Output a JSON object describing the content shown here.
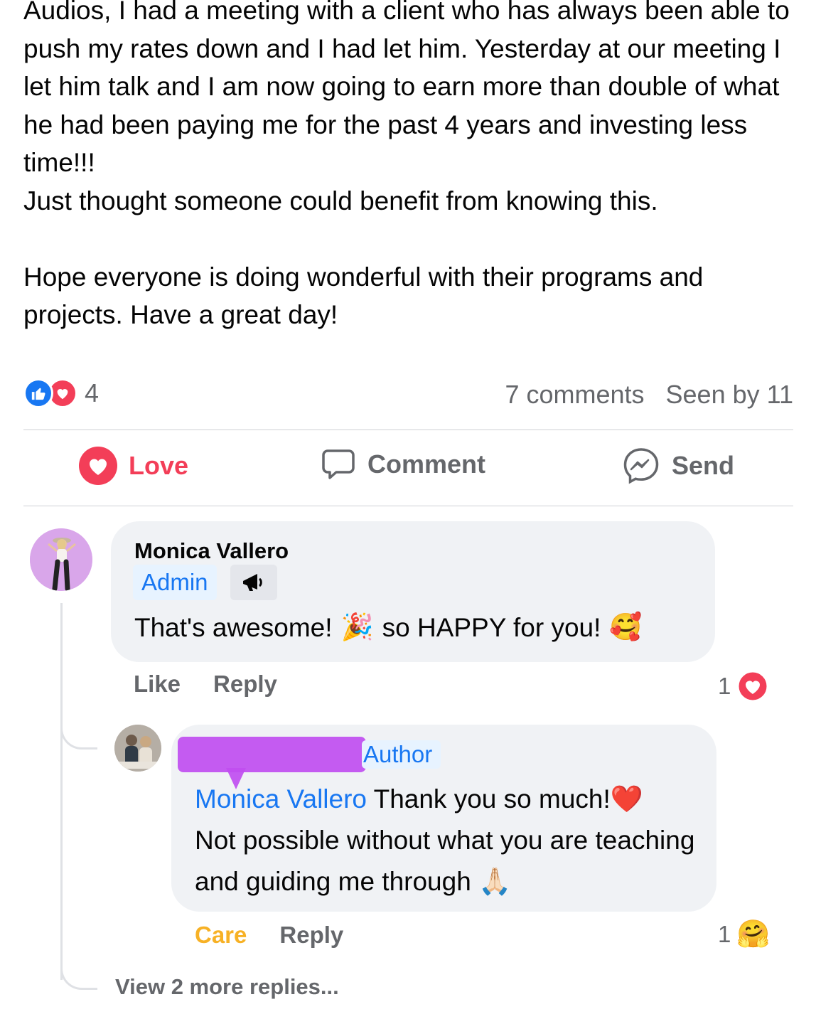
{
  "post": {
    "paragraphs": [
      "Audios, I had a meeting with a client who has always been able to push my rates down and I had let him. Yesterday at our meeting I let him talk and I am now going to earn more than double of what he had been paying me for the past 4 years and investing less time!!!\nJust thought someone could benefit from knowing this.",
      "Hope everyone is doing wonderful with their programs and projects. Have a great day!"
    ]
  },
  "stats": {
    "reaction_icons": [
      "like-icon",
      "love-icon"
    ],
    "reaction_count": "4",
    "comments": "7 comments",
    "seen_by": "Seen by 11"
  },
  "actions": {
    "love": "Love",
    "comment": "Comment",
    "send": "Send"
  },
  "comment1": {
    "author": "Monica Vallero",
    "badge": "Admin",
    "badge_icon": "megaphone-icon",
    "text_part1": "That's awesome!",
    "text_part2": "so HAPPY for you!",
    "emoji1": "🎉",
    "emoji2": "🥰",
    "like": "Like",
    "reply": "Reply",
    "reaction_count": "1",
    "reaction_icon": "love-icon"
  },
  "comment2": {
    "badge": "Author",
    "mention": "Monica Vallero",
    "text_line1": " Thank you so much!",
    "heart": "❤️",
    "text_line2": "Not possible without what you are teaching and guiding me through ",
    "emoji": "🙏🏻",
    "care": "Care",
    "reply": "Reply",
    "reaction_count": "1",
    "reaction_icon": "care-icon",
    "care_emoji": "🤗"
  },
  "view_more": "View 2 more replies...",
  "colors": {
    "brand_blue": "#1877f2",
    "love_red": "#f33e58",
    "care_yellow": "#f7b125",
    "secondary_text": "#65676b",
    "bubble_bg": "#f0f2f5"
  }
}
